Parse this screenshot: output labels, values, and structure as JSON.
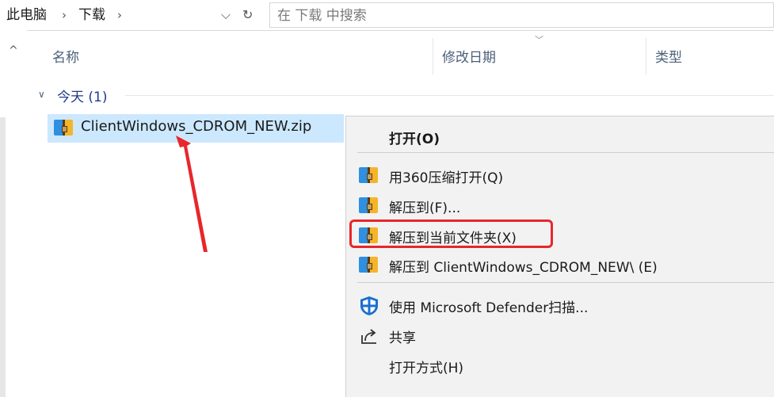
{
  "breadcrumb": {
    "items": [
      "此电脑",
      "下载"
    ],
    "separator_icon": "chevron-right-icon"
  },
  "nav": {
    "dropdown_icon": "chevron-down-icon",
    "refresh_icon": "refresh-icon"
  },
  "search": {
    "placeholder": "在 下载 中搜索"
  },
  "columns": {
    "name": "名称",
    "date_modified": "修改日期",
    "type": "类型"
  },
  "group": {
    "label": "今天 (1)"
  },
  "file": {
    "name": "ClientWindows_CDROM_NEW.zip",
    "icon": "zip-archive-icon",
    "selected": true
  },
  "context_menu": {
    "items": [
      {
        "label": "打开(O)",
        "icon": "",
        "bold": true
      },
      {
        "label": "用360压缩打开(Q)",
        "icon": "zip-archive-icon"
      },
      {
        "label": "解压到(F)...",
        "icon": "zip-archive-icon"
      },
      {
        "label": "解压到当前文件夹(X)",
        "icon": "zip-archive-icon",
        "highlighted": true
      },
      {
        "label": "解压到 ClientWindows_CDROM_NEW\\ (E)",
        "icon": "zip-archive-icon"
      },
      {
        "label": "使用 Microsoft Defender扫描...",
        "icon": "defender-shield-icon"
      },
      {
        "label": "共享",
        "icon": "share-icon"
      },
      {
        "label": "打开方式(H)",
        "icon": ""
      }
    ]
  },
  "annotation": {
    "highlight_color": "#e8262b",
    "arrow_color": "#e8262b"
  },
  "colors": {
    "selection": "#cce8ff",
    "menu_bg": "#f2f2f2",
    "header_text": "#4c607a",
    "group_text": "#1e3a8a"
  }
}
